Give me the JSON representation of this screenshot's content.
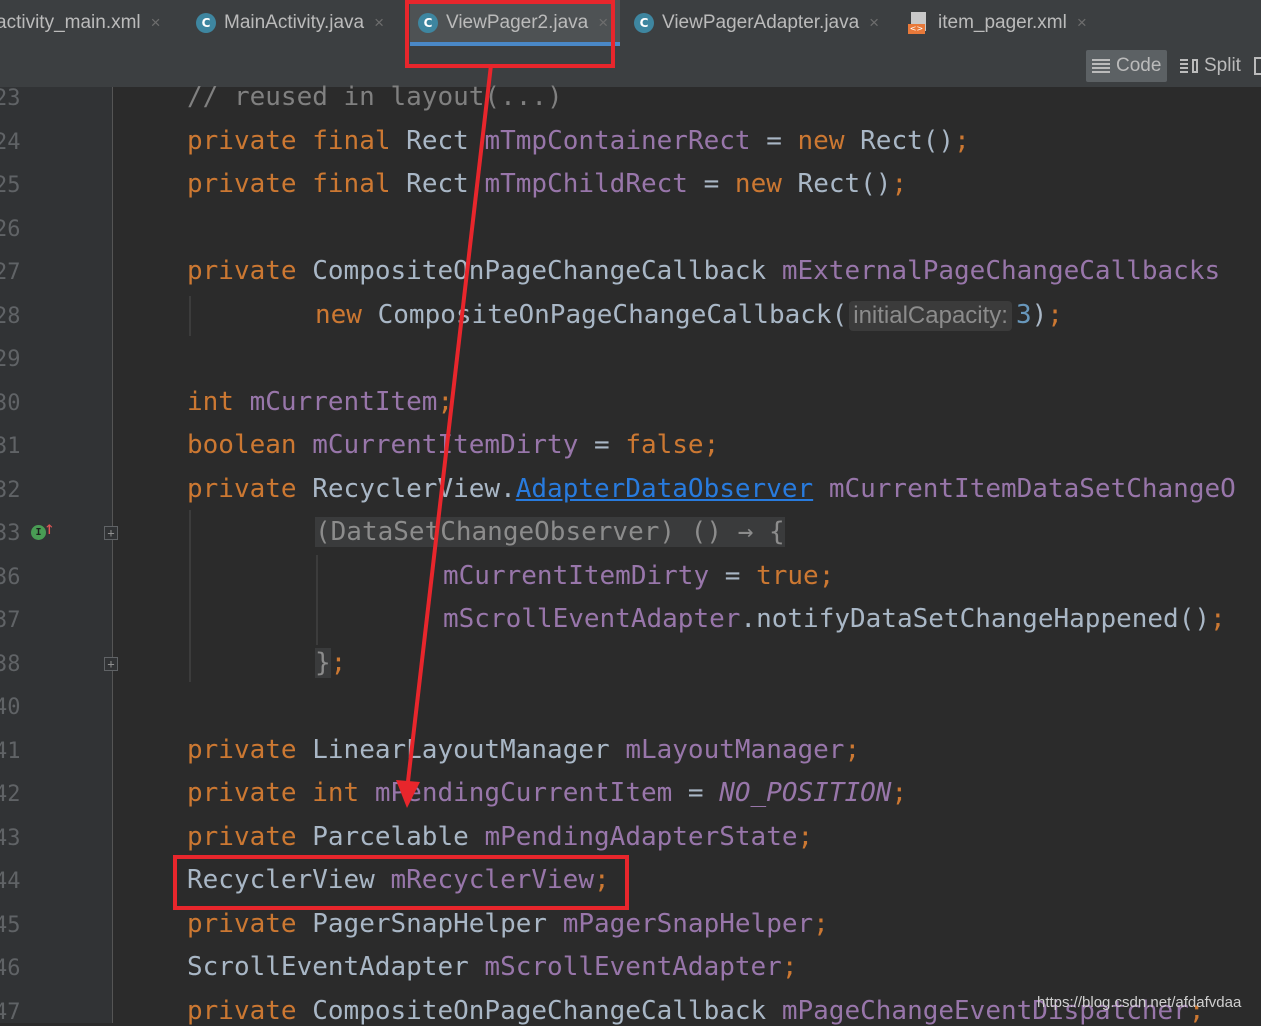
{
  "tabs": [
    {
      "label": "activity_main.xml",
      "icon": "xml-file-icon"
    },
    {
      "label": "MainActivity.java",
      "icon": "java-class-icon"
    },
    {
      "label": "ViewPager2.java",
      "icon": "java-class-locked-icon"
    },
    {
      "label": "ViewPagerAdapter.java",
      "icon": "java-class-icon"
    },
    {
      "label": "item_pager.xml",
      "icon": "xml-file-icon"
    }
  ],
  "tab_close_glyph": "×",
  "file_icon_letter": "C",
  "xml_icon_letter": "<>",
  "toolbar": {
    "code_label": "Code",
    "split_label": "Split"
  },
  "line_numbers": [
    "23",
    "24",
    "25",
    "26",
    "27",
    "28",
    "29",
    "30",
    "31",
    "32",
    "33",
    "36",
    "37",
    "38",
    "40",
    "41",
    "42",
    "43",
    "44",
    "45",
    "46",
    "47"
  ],
  "code": {
    "l23": {
      "comment": "// reused in layout(...)"
    },
    "l24": {
      "kw1": "private",
      "kw2": "final",
      "type": "Rect",
      "field": "mTmpContainerRect",
      "op": " = ",
      "kw3": "new",
      "rest": " Rect()",
      "semi": ";"
    },
    "l25": {
      "kw1": "private",
      "kw2": "final",
      "type": "Rect",
      "field": "mTmpChildRect",
      "op": " = ",
      "kw3": "new",
      "rest": " Rect()",
      "semi": ";"
    },
    "l27": {
      "kw1": "private",
      "type": "CompositeOnPageChangeCallback",
      "field": "mExternalPageChangeCallbacks"
    },
    "l28": {
      "kw": "new",
      "call": "CompositeOnPageChangeCallback(",
      "hint": "initialCapacity:",
      "num": "3",
      "close": ")",
      "semi": ";"
    },
    "l30": {
      "kw": "int",
      "field": "mCurrentItem",
      "semi": ";"
    },
    "l31": {
      "kw": "boolean",
      "field": "mCurrentItemDirty",
      "op": " = ",
      "val": "false",
      "semi": ";"
    },
    "l32": {
      "kw": "private",
      "type": "RecyclerView.",
      "link": "AdapterDataObserver",
      "field": "mCurrentItemDataSetChangeO"
    },
    "l33": {
      "lambda": "(DataSetChangeObserver) () → {"
    },
    "l36": {
      "field": "mCurrentItemDirty",
      "op": " = ",
      "val": "true",
      "semi": ";"
    },
    "l37": {
      "field": "mScrollEventAdapter",
      "rest": ".notifyDataSetChangeHappened()",
      "semi": ";"
    },
    "l38": {
      "brace": "}",
      "semi": ";"
    },
    "l41": {
      "kw": "private",
      "type": "LinearLayoutManager",
      "field": "mLayoutManager",
      "semi": ";"
    },
    "l42": {
      "kw1": "private",
      "kw2": "int",
      "field": "mPendingCurrentItem",
      "op": " = ",
      "const": "NO_POSITION",
      "semi": ";"
    },
    "l43": {
      "kw": "private",
      "type": "Parcelable",
      "field": "mPendingAdapterState",
      "semi": ";"
    },
    "l44": {
      "type": "RecyclerView",
      "field": "mRecyclerView",
      "semi": ";"
    },
    "l45": {
      "kw": "private",
      "type": "PagerSnapHelper",
      "field": "mPagerSnapHelper",
      "semi": ";"
    },
    "l46": {
      "type": "ScrollEventAdapter",
      "field": "mScrollEventAdapter",
      "semi": ";"
    },
    "l47": {
      "kw": "private",
      "type": "CompositeOnPageChangeCallback",
      "field": "mPageChangeEventDispatcher",
      "semi": ";"
    }
  },
  "impl_marker_letter": "I",
  "fold_glyph": "+",
  "watermark": "https://blog.csdn.net/afdafvdaa",
  "colors": {
    "annotation_red": "#e8262c",
    "keyword": "#cc7832",
    "field": "#9876aa",
    "active_tab_underline": "#4a88c7"
  }
}
